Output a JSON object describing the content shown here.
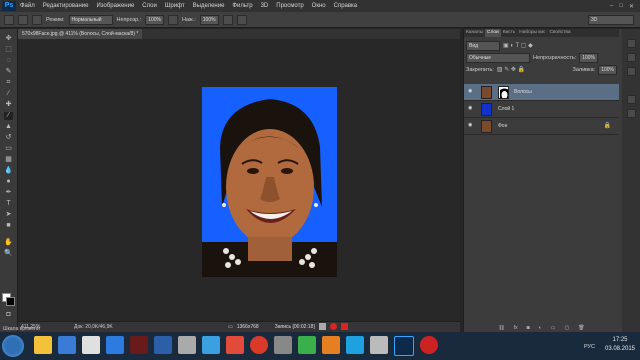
{
  "app": {
    "logo": "Ps"
  },
  "menu": [
    "Файл",
    "Редактирование",
    "Изображение",
    "Слои",
    "Шрифт",
    "Выделение",
    "Фильтр",
    "3D",
    "Просмотр",
    "Окно",
    "Справка"
  ],
  "options": {
    "mode_label": "Режим:",
    "mode_value": "Нормальный",
    "opacity_label": "Непрозр.:",
    "opacity_value": "100%",
    "flow_label": "Наж.:",
    "flow_value": "100%",
    "workspace_value": "3D"
  },
  "document": {
    "tab_title": "570x98Face.jpg @ 411% (Волосы, Слой-маска/8) *"
  },
  "status": {
    "zoom": "411,25%",
    "doc": "Док: 20,0K/46,9K"
  },
  "recorder": {
    "resolution": "1366x768",
    "label": "Запись [00:02:18]"
  },
  "panel": {
    "tabs": [
      "Каналы",
      "Слои",
      "Кисть",
      "Наборы кис",
      "Свойства"
    ],
    "active_tab": 1,
    "kind_label": "Вид",
    "blend_mode": "Обычные",
    "opacity_label": "Непрозрачность:",
    "opacity_value": "100%",
    "lock_label": "Закрепить:",
    "fill_label": "Заливка:",
    "fill_value": "100%",
    "layers": [
      {
        "name": "Волосы",
        "selected": true,
        "has_mask": true
      },
      {
        "name": "Слой 1",
        "selected": false,
        "has_mask": false,
        "fill_color": "#1133cc"
      },
      {
        "name": "Фон",
        "selected": false,
        "has_mask": false,
        "locked": true
      }
    ]
  },
  "taskbar": {
    "start_label": "Шкала времени",
    "lang": "РУС",
    "time": "17:25",
    "date": "03.08.2015"
  },
  "colors": {
    "menubar": "#323232",
    "canvas_bg": "#282828",
    "photo_bg": "#1560ff",
    "selection": "#5a6e85",
    "taskbar": "#1a2a3d"
  }
}
